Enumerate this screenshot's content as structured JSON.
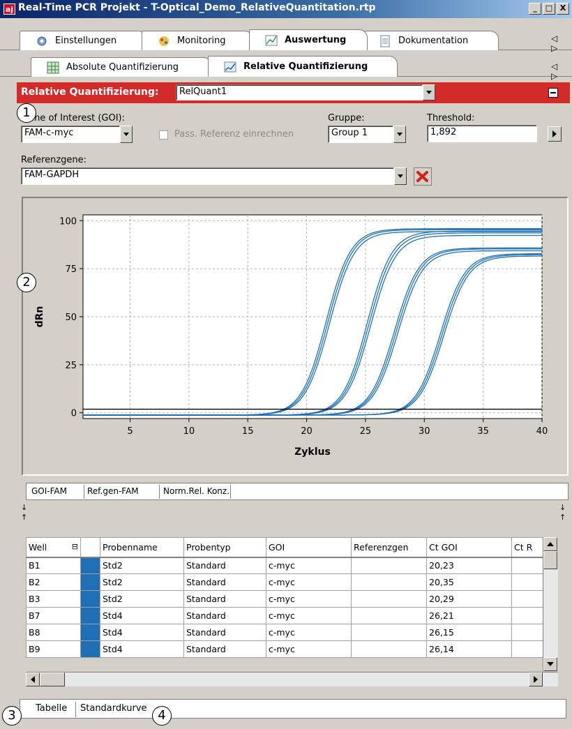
{
  "window": {
    "app_icon": "aj",
    "title": "Real-Time PCR Projekt - T-Optical_Demo_RelativeQuantitation.rtp",
    "controls": [
      "_",
      "□",
      "X"
    ]
  },
  "main_tabs": [
    {
      "label": "Einstellungen",
      "icon": "gear-icon"
    },
    {
      "label": "Monitoring",
      "icon": "monitoring-icon"
    },
    {
      "label": "Auswertung",
      "icon": "chart-icon",
      "active": true
    },
    {
      "label": "Dokumentation",
      "icon": "document-icon"
    }
  ],
  "sub_tabs": [
    {
      "label": "Absolute Quantifizierung",
      "icon": "grid-icon"
    },
    {
      "label": "Relative Quantifizierung",
      "icon": "relative-chart-icon",
      "active": true
    }
  ],
  "tab_scroll": "◁ ▷",
  "relquant": {
    "label": "Relative Quantifizierung:",
    "value": "RelQuant1"
  },
  "form": {
    "goi_label": "Gene of Interest (GOI):",
    "goi_value": "FAM-c-myc",
    "passive_ref_label": "Pass. Referenz einrechnen",
    "gruppe_label": "Gruppe:",
    "gruppe_value": "Group 1",
    "threshold_label": "Threshold:",
    "threshold_value": "1,892",
    "refgene_label": "Referenzgene:",
    "refgene_value": "FAM-GAPDH"
  },
  "callouts": [
    "1",
    "2",
    "3",
    "4"
  ],
  "chart_data": {
    "type": "line",
    "xlabel": "Zyklus",
    "ylabel": "dRn",
    "xlim": [
      1,
      40
    ],
    "ylim": [
      -3,
      103
    ],
    "xticks": [
      5,
      10,
      15,
      20,
      25,
      30,
      35,
      40
    ],
    "yticks": [
      0,
      25,
      50,
      75,
      100
    ],
    "grid": true,
    "threshold": 1.892,
    "line_color": "#1f6fb4",
    "groups": [
      {
        "midpoint": 21.8,
        "plateau": [
          97,
          96.5,
          95.5
        ],
        "onset": 16.5
      },
      {
        "midpoint": 25.3,
        "plateau": [
          95.8,
          94.8,
          93.5
        ],
        "onset": 20
      },
      {
        "midpoint": 27.6,
        "plateau": [
          87,
          86.5,
          85.5
        ],
        "onset": 22.5
      },
      {
        "midpoint": 31.5,
        "plateau": [
          84,
          83.5,
          82.8
        ],
        "onset": 26
      }
    ]
  },
  "chart_tabs": [
    "GOI-FAM",
    "Ref.gen-FAM",
    "Norm.Rel. Konz."
  ],
  "table": {
    "columns": [
      "Well",
      "",
      "Probenname",
      "Probentyp",
      "GOI",
      "Referenzgen",
      "Ct GOI",
      "Ct R"
    ],
    "rows": [
      {
        "well": "B1",
        "name": "Std2",
        "type": "Standard",
        "goi": "c-myc",
        "ref": "",
        "ct_goi": "20,23"
      },
      {
        "well": "B2",
        "name": "Std2",
        "type": "Standard",
        "goi": "c-myc",
        "ref": "",
        "ct_goi": "20,35"
      },
      {
        "well": "B3",
        "name": "Std2",
        "type": "Standard",
        "goi": "c-myc",
        "ref": "",
        "ct_goi": "20,29"
      },
      {
        "well": "B7",
        "name": "Std4",
        "type": "Standard",
        "goi": "c-myc",
        "ref": "",
        "ct_goi": "26,21"
      },
      {
        "well": "B8",
        "name": "Std4",
        "type": "Standard",
        "goi": "c-myc",
        "ref": "",
        "ct_goi": "26,15"
      },
      {
        "well": "B9",
        "name": "Std4",
        "type": "Standard",
        "goi": "c-myc",
        "ref": "",
        "ct_goi": "26,14"
      }
    ]
  },
  "bottom_tabs": [
    "Tabelle",
    "Standardkurve"
  ],
  "splitter_arrows": [
    "↓",
    "↑"
  ]
}
